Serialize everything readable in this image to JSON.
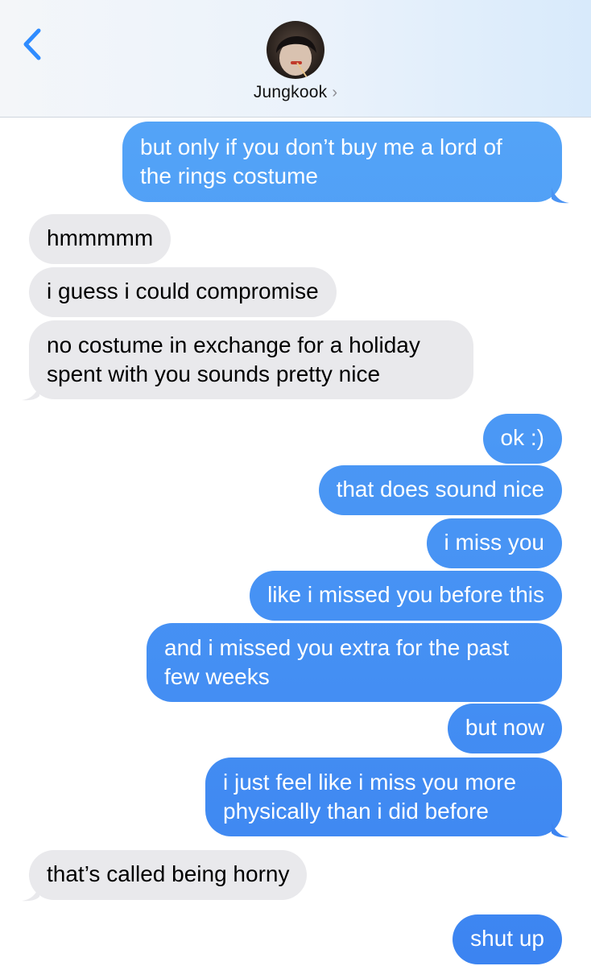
{
  "header": {
    "contact_name": "Jungkook",
    "chevron": "›"
  },
  "colors": {
    "sent_top": "#57a8f8",
    "sent_bottom": "#3c84f1",
    "received": "#e9e9ec",
    "back_arrow": "#2f8cff"
  },
  "messages": [
    {
      "from": "me",
      "text": "but only if you don’t buy me a lord of the rings costume"
    },
    {
      "from": "them",
      "text": "hmmmmm"
    },
    {
      "from": "them",
      "text": "i guess i could compromise"
    },
    {
      "from": "them",
      "text": "no costume in exchange for a holiday spent with you sounds pretty nice"
    },
    {
      "from": "me",
      "text": "ok :)"
    },
    {
      "from": "me",
      "text": "that does sound nice"
    },
    {
      "from": "me",
      "text": "i miss you"
    },
    {
      "from": "me",
      "text": "like i missed you before this"
    },
    {
      "from": "me",
      "text": "and i missed you extra for the past few weeks"
    },
    {
      "from": "me",
      "text": "but now"
    },
    {
      "from": "me",
      "text": "i just feel like i miss you more physically than i did before"
    },
    {
      "from": "them",
      "text": "that’s called being horny"
    },
    {
      "from": "me",
      "text": "shut up"
    }
  ],
  "message_lines": {
    "m0": [
      "but only if you don’t buy me a lord of",
      "the rings costume"
    ],
    "m3": [
      "no costume in exchange for a holiday",
      "spent with you sounds pretty nice"
    ],
    "m8": [
      "and i missed you extra for the past",
      "few weeks"
    ],
    "m10": [
      "i just feel like i miss you more",
      "physically than i did before"
    ]
  }
}
